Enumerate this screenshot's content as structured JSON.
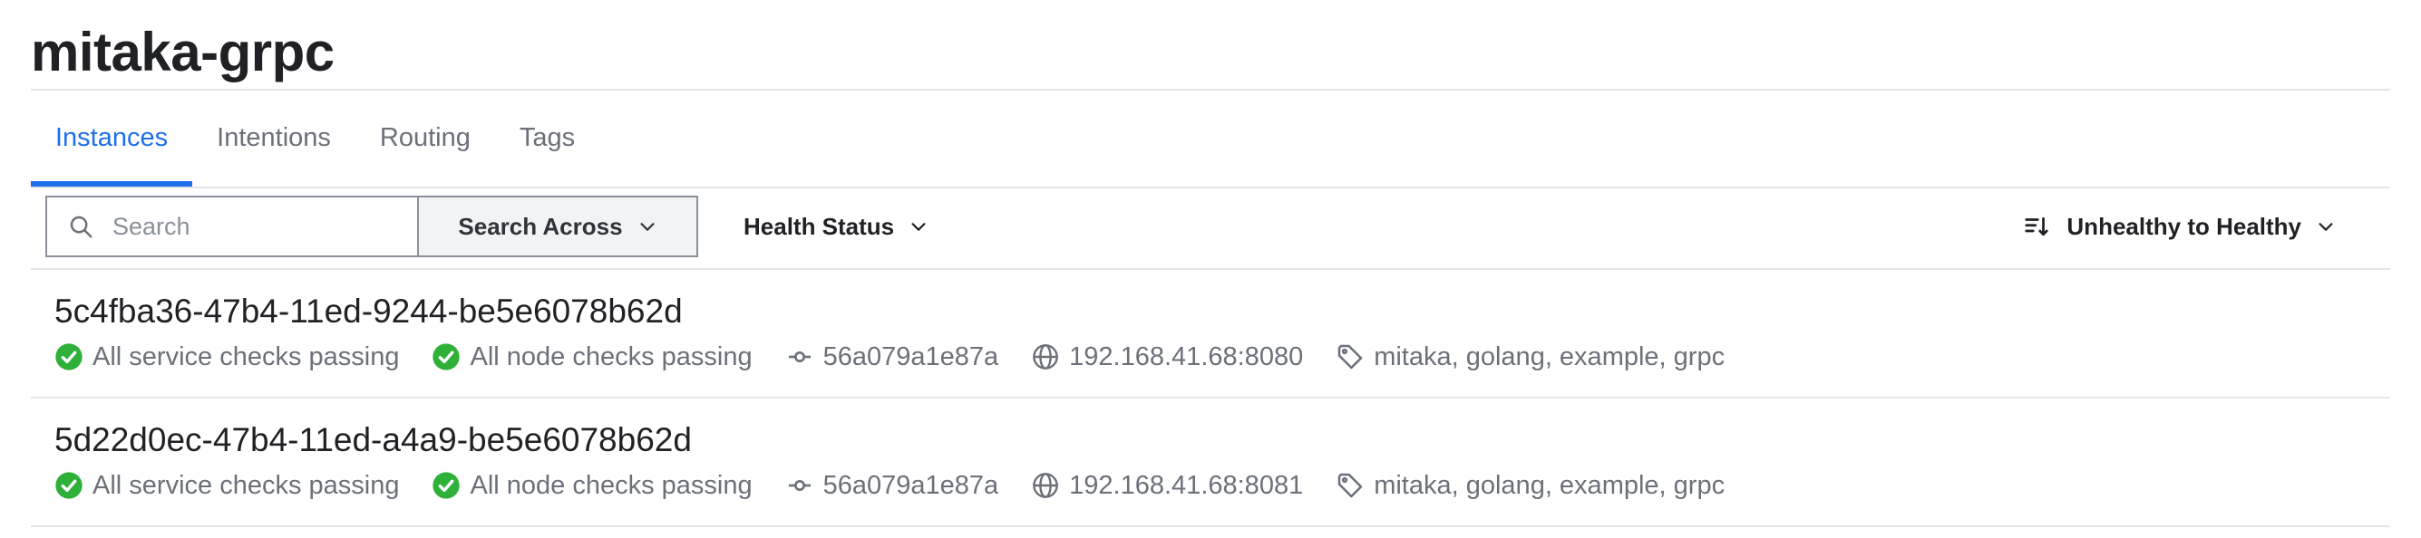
{
  "page": {
    "title": "mitaka-grpc"
  },
  "tabs": [
    {
      "label": "Instances",
      "active": true
    },
    {
      "label": "Intentions",
      "active": false
    },
    {
      "label": "Routing",
      "active": false
    },
    {
      "label": "Tags",
      "active": false
    }
  ],
  "toolbar": {
    "search_placeholder": "Search",
    "search_value": "",
    "search_across_label": "Search Across",
    "health_status_label": "Health Status",
    "sort_label": "Unhealthy to Healthy"
  },
  "colors": {
    "accent": "#1f6feb",
    "passing": "#2eb039",
    "muted_text": "#6b7079",
    "divider": "#e2e4e7"
  },
  "icons": {
    "search": "search-icon",
    "chevron": "chevron-down-icon",
    "sort": "sort-icon",
    "check": "check-circle-icon",
    "node": "git-commit-icon",
    "address": "globe-icon",
    "tags": "tag-icon"
  },
  "instances": [
    {
      "id": "5c4fba36-47b4-11ed-9244-be5e6078b62d",
      "service_checks": "All service checks passing",
      "node_checks": "All node checks passing",
      "node": "56a079a1e87a",
      "address": "192.168.41.68:8080",
      "tags": "mitaka, golang, example, grpc"
    },
    {
      "id": "5d22d0ec-47b4-11ed-a4a9-be5e6078b62d",
      "service_checks": "All service checks passing",
      "node_checks": "All node checks passing",
      "node": "56a079a1e87a",
      "address": "192.168.41.68:8081",
      "tags": "mitaka, golang, example, grpc"
    }
  ]
}
